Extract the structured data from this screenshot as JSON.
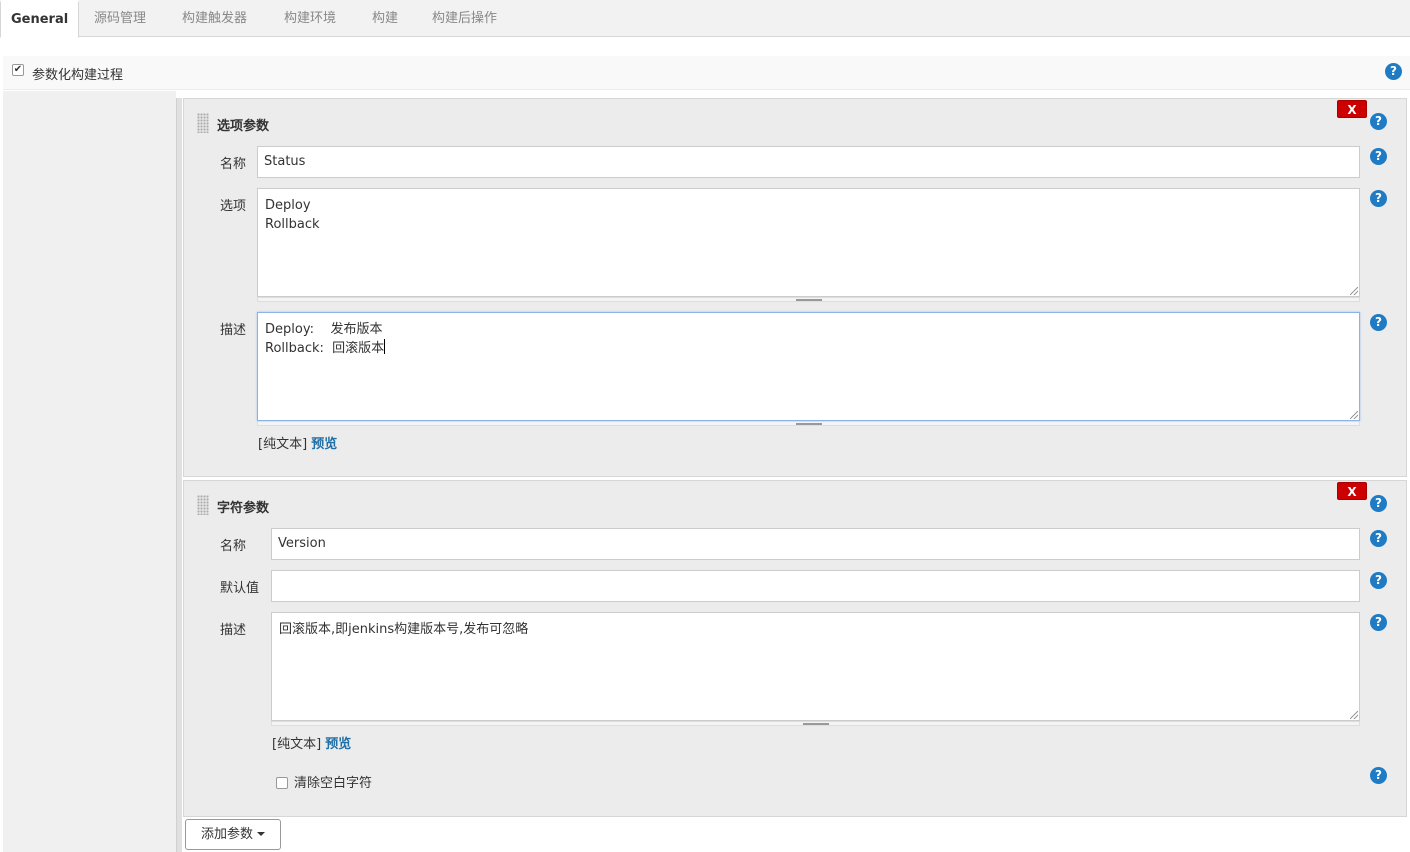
{
  "tabs": [
    {
      "label": "General"
    },
    {
      "label": "源码管理"
    },
    {
      "label": "构建触发器"
    },
    {
      "label": "构建环境"
    },
    {
      "label": "构建"
    },
    {
      "label": "构建后操作"
    }
  ],
  "param_toggle": {
    "label": "参数化构建过程",
    "checked": true
  },
  "help_glyph": "?",
  "delete_glyph": "X",
  "choice_param": {
    "title": "选项参数",
    "name_label": "名称",
    "name_value": "Status",
    "choices_label": "选项",
    "choices_lines": [
      "Deploy",
      "Rollback"
    ],
    "desc_label": "描述",
    "desc_lines": [
      "Deploy:    发布版本",
      "Rollback:  回滚版本"
    ],
    "format_text": "[纯文本]",
    "preview_link": "预览"
  },
  "string_param": {
    "title": "字符参数",
    "name_label": "名称",
    "name_value": "Version",
    "default_label": "默认值",
    "default_value": "",
    "desc_label": "描述",
    "desc_value": "回滚版本,即jenkins构建版本号,发布可忽略",
    "format_text": "[纯文本]",
    "preview_link": "预览",
    "trim_label": "清除空白字符",
    "trim_checked": false
  },
  "add_param_button": "添加参数",
  "colors": {
    "help_icon": "#1f7bc4",
    "delete_button": "#cc0000",
    "link": "#1f6fa8",
    "focus_border": "#8ab4e8"
  },
  "icons": {
    "help": "help-icon",
    "delete": "delete-icon",
    "drag": "drag-handle-icon",
    "dropdown": "caret-down-icon"
  }
}
